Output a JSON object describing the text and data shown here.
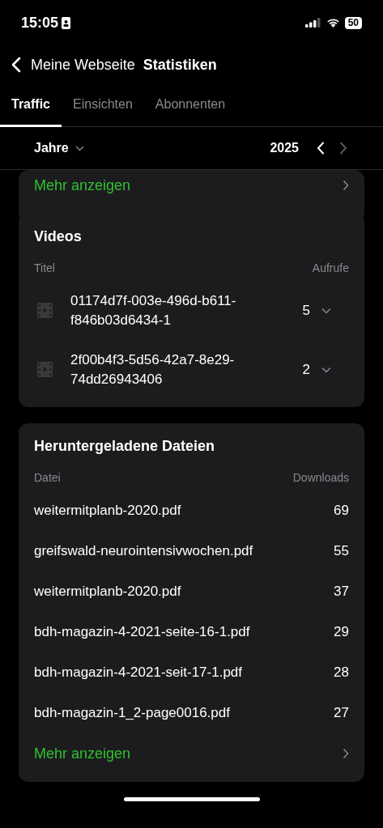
{
  "status_bar": {
    "time": "15:05",
    "battery": "50"
  },
  "nav": {
    "back_label": "Meine Webseite",
    "title": "Statistiken"
  },
  "tabs": [
    {
      "label": "Traffic",
      "selected": true
    },
    {
      "label": "Einsichten",
      "selected": false
    },
    {
      "label": "Abonnenten",
      "selected": false
    }
  ],
  "period": {
    "label": "Jahre",
    "year": "2025",
    "prev_disabled": false,
    "next_disabled": true
  },
  "top_card": {
    "more_link": "Mehr anzeigen"
  },
  "videos": {
    "title": "Videos",
    "columns": [
      "Titel",
      "Aufrufe"
    ],
    "rows": [
      {
        "title": "01174d7f-003e-496d-b611-f846b03d6434-1",
        "views": "5",
        "expanded": false
      },
      {
        "title": "2f00b4f3-5d56-42a7-8e29-74dd26943406",
        "views": "2",
        "expanded": false
      }
    ]
  },
  "downloads": {
    "title": "Heruntergeladene Dateien",
    "columns": [
      "Datei",
      "Downloads"
    ],
    "rows": [
      {
        "file": "weitermitplanb-2020.pdf",
        "count": "69"
      },
      {
        "file": "greifswald-neurointensivwochen.pdf",
        "count": "55"
      },
      {
        "file": "weitermitplanb-2020.pdf",
        "count": "37"
      },
      {
        "file": "bdh-magazin-4-2021-seite-16-1.pdf",
        "count": "29"
      },
      {
        "file": "bdh-magazin-4-2021-seit-17-1.pdf",
        "count": "28"
      },
      {
        "file": "bdh-magazin-1_2-page0016.pdf",
        "count": "27"
      }
    ],
    "more_link": "Mehr anzeigen"
  }
}
